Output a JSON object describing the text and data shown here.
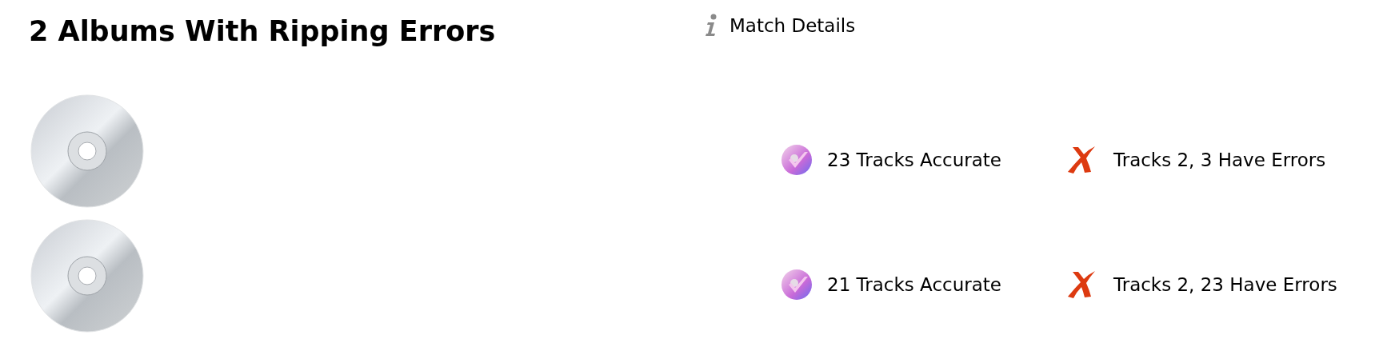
{
  "title": "2 Albums With Ripping Errors",
  "match_details": {
    "label": "Match Details"
  },
  "albums": [
    {
      "accurate": "23 Tracks Accurate",
      "errors": "Tracks 2, 3 Have Errors"
    },
    {
      "accurate": "21 Tracks Accurate",
      "errors": "Tracks 2, 23 Have Errors"
    }
  ]
}
